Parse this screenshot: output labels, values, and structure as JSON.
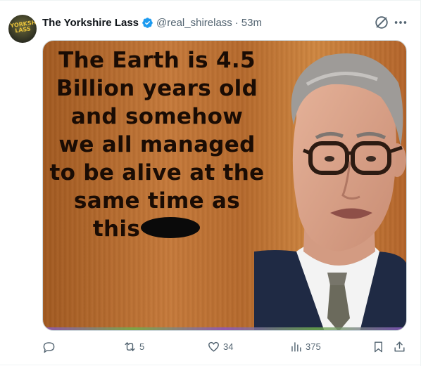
{
  "author": {
    "display_name": "The Yorkshire Lass",
    "handle": "@real_shirelass",
    "separator": "·",
    "time_ago": "53m",
    "avatar_text": "YORKSHIRE LASS",
    "verified": true
  },
  "media": {
    "caption_lines": [
      "The Earth is 4.5",
      "Billion years old",
      "and somehow",
      "we all managed",
      "to be alive at the",
      "same time as",
      "this"
    ],
    "redacted": true
  },
  "actions": {
    "reply_count": "",
    "retweet_count": "5",
    "like_count": "34",
    "view_count": "375"
  },
  "colors": {
    "text": "#0f1419",
    "muted": "#536471",
    "verified_blue": "#1d9bf0",
    "border": "#eff3f4"
  }
}
